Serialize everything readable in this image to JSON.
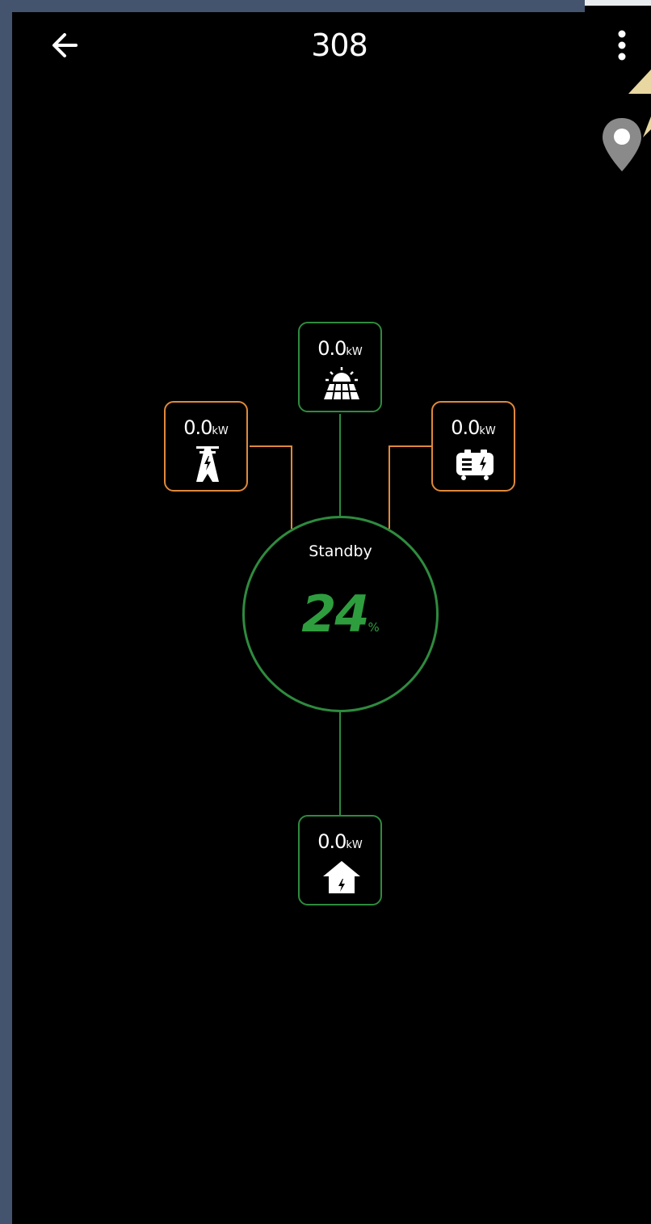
{
  "header": {
    "title": "308",
    "back_icon": "arrow-left-icon",
    "menu_icon": "more-vertical-icon"
  },
  "map_marker_icon": "location-pin-icon",
  "energy_flow": {
    "solar": {
      "value": "0.0",
      "unit": "kW",
      "icon": "solar-panel-icon"
    },
    "grid": {
      "value": "0.0",
      "unit": "kW",
      "icon": "power-tower-icon"
    },
    "generator": {
      "value": "0.0",
      "unit": "kW",
      "icon": "generator-icon"
    },
    "load": {
      "value": "0.0",
      "unit": "kW",
      "icon": "home-icon"
    },
    "battery": {
      "status": "Standby",
      "soc": "24",
      "soc_unit": "%"
    }
  },
  "colors": {
    "background": "#000000",
    "active_line": "#2e8b3e",
    "inactive_line": "#e0893b",
    "soc_text": "#2e9d3e",
    "frame_edge": "#44546e"
  }
}
